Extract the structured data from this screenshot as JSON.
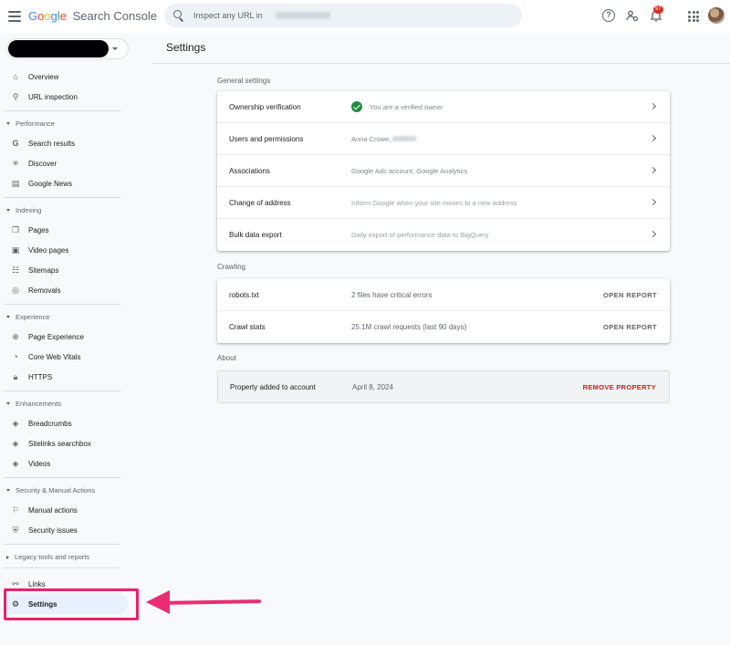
{
  "header": {
    "logo_google": "Google",
    "logo_product": "Search Console",
    "search_placeholder": "Inspect any URL in",
    "notification_count": "97"
  },
  "sidebar": {
    "items_top": [
      {
        "label": "Overview",
        "icon": "home-icon"
      },
      {
        "label": "URL inspection",
        "icon": "search-icon"
      }
    ],
    "sections": [
      {
        "title": "Performance",
        "items": [
          {
            "label": "Search results",
            "icon": "google-g-icon"
          },
          {
            "label": "Discover",
            "icon": "asterisk-icon"
          },
          {
            "label": "Google News",
            "icon": "news-icon"
          }
        ]
      },
      {
        "title": "Indexing",
        "items": [
          {
            "label": "Pages",
            "icon": "pages-icon"
          },
          {
            "label": "Video pages",
            "icon": "video-page-icon"
          },
          {
            "label": "Sitemaps",
            "icon": "sitemap-icon"
          },
          {
            "label": "Removals",
            "icon": "eye-off-icon"
          }
        ]
      },
      {
        "title": "Experience",
        "items": [
          {
            "label": "Page Experience",
            "icon": "plus-circle-icon"
          },
          {
            "label": "Core Web Vitals",
            "icon": "gauge-icon"
          },
          {
            "label": "HTTPS",
            "icon": "lock-icon"
          }
        ]
      },
      {
        "title": "Enhancements",
        "items": [
          {
            "label": "Breadcrumbs",
            "icon": "layers-icon"
          },
          {
            "label": "Sitelinks searchbox",
            "icon": "layers-icon"
          },
          {
            "label": "Videos",
            "icon": "layers-icon"
          }
        ]
      },
      {
        "title": "Security & Manual Actions",
        "items": [
          {
            "label": "Manual actions",
            "icon": "flag-icon"
          },
          {
            "label": "Security issues",
            "icon": "shield-icon"
          }
        ]
      }
    ],
    "legacy": "Legacy tools and reports",
    "links": "Links",
    "settings": "Settings"
  },
  "main": {
    "title": "Settings",
    "general_label": "General settings",
    "general_rows": [
      {
        "label": "Ownership verification",
        "value": "You are a verified owner"
      },
      {
        "label": "Users and permissions",
        "value": "Anna Crowe,"
      },
      {
        "label": "Associations",
        "value": "Google Ads account, Google Analytics"
      },
      {
        "label": "Change of address",
        "value": "Inform Google when your site moves to a new address"
      },
      {
        "label": "Bulk data export",
        "value": "Daily export of performance data to BigQuery"
      }
    ],
    "crawling_label": "Crawling",
    "crawling_rows": [
      {
        "label": "robots.txt",
        "value": "2 files have critical errors",
        "action": "OPEN REPORT"
      },
      {
        "label": "Crawl stats",
        "value": "25.1M crawl requests (last 90 days)",
        "action": "OPEN REPORT"
      }
    ],
    "about_label": "About",
    "about": {
      "label": "Property added to account",
      "value": "April 8, 2024",
      "action": "REMOVE PROPERTY"
    }
  },
  "colors": {
    "accent": "#1a73e8",
    "annotation": "#e9236b",
    "verified": "#1e8e3e",
    "danger": "#c5221f"
  }
}
